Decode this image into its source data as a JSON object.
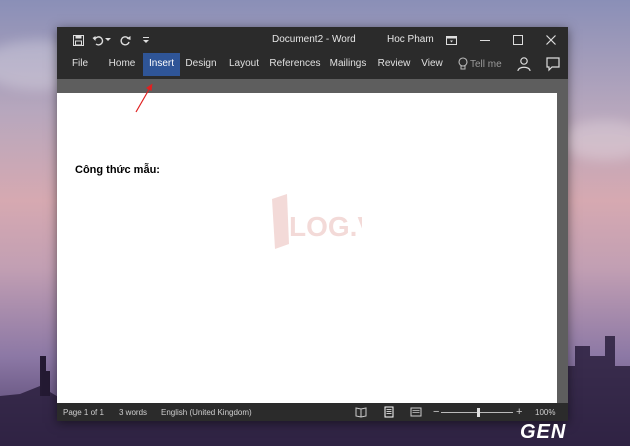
{
  "window": {
    "title": "Document2  -  Word",
    "user": "Hoc Pham"
  },
  "ribbon": {
    "tabs": [
      {
        "label": "File"
      },
      {
        "label": "Home"
      },
      {
        "label": "Insert",
        "active": true
      },
      {
        "label": "Design"
      },
      {
        "label": "Layout"
      },
      {
        "label": "References"
      },
      {
        "label": "Mailings"
      },
      {
        "label": "Review"
      },
      {
        "label": "View"
      }
    ],
    "tell_me": "Tell me"
  },
  "document": {
    "body_text": "Công thức mẫu:"
  },
  "status": {
    "page": "Page 1 of 1",
    "words": "3 words",
    "language": "English (United Kingdom)",
    "zoom": "100%",
    "zoom_level_percent": 100
  },
  "watermark": {
    "text": "LOG.VN"
  },
  "branding": {
    "logo_text": "GEN"
  },
  "colors": {
    "accent": "#2f5597",
    "chrome": "#2b2b2b",
    "annotation": "#e02020"
  }
}
